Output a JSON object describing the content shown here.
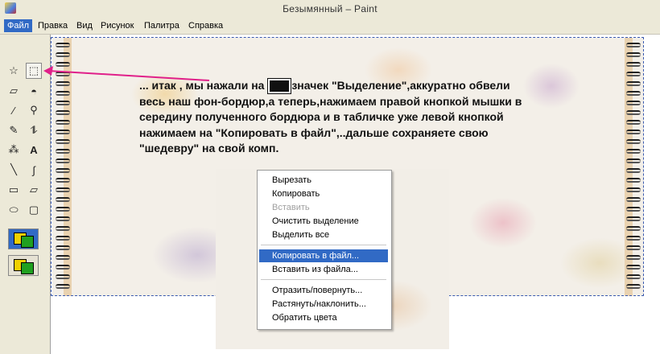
{
  "window": {
    "title": "Безымянный – Paint"
  },
  "menubar": {
    "items": [
      {
        "label": "Файл",
        "active": true
      },
      {
        "label": "Правка"
      },
      {
        "label": "Вид"
      },
      {
        "label": "Рисунок"
      },
      {
        "label": "Палитра"
      },
      {
        "label": "Справка"
      }
    ]
  },
  "toolbox": {
    "tools": [
      {
        "name": "free-form-select-icon",
        "glyph": "☆"
      },
      {
        "name": "select-icon",
        "glyph": "⬚",
        "selected": true
      },
      {
        "name": "eraser-icon",
        "glyph": "▱"
      },
      {
        "name": "fill-icon",
        "glyph": "◓"
      },
      {
        "name": "eyedropper-icon",
        "glyph": "⁄"
      },
      {
        "name": "magnifier-icon",
        "glyph": "⚲"
      },
      {
        "name": "pencil-icon",
        "glyph": "✎"
      },
      {
        "name": "brush-icon",
        "glyph": "⥮"
      },
      {
        "name": "airbrush-icon",
        "glyph": "⁂"
      },
      {
        "name": "text-icon",
        "glyph": "A"
      },
      {
        "name": "line-icon",
        "glyph": "╲"
      },
      {
        "name": "curve-icon",
        "glyph": "∫"
      },
      {
        "name": "rectangle-icon",
        "glyph": "▭"
      },
      {
        "name": "polygon-icon",
        "glyph": "▱"
      },
      {
        "name": "ellipse-icon",
        "glyph": "⬭"
      },
      {
        "name": "rounded-rectangle-icon",
        "glyph": "▢"
      }
    ]
  },
  "canvas": {
    "instruction_part1": "... итак , мы нажали на ",
    "instruction_part2": "значек \"Выделение\",аккуратно обвели весь наш фон-бордюр,а теперь,нажимаем правой кнопкой мышки в середину полученного бордюра и в табличке уже левой кнопкой нажимаем на \"Копировать в файл\",..дальше сохраняете свою \"шедевру\" на свой комп."
  },
  "context_menu": {
    "items": [
      {
        "label": "Вырезать"
      },
      {
        "label": "Копировать"
      },
      {
        "label": "Вставить",
        "disabled": true
      },
      {
        "label": "Очистить выделение"
      },
      {
        "label": "Выделить все"
      },
      {
        "label": "Копировать в файл...",
        "highlighted": true
      },
      {
        "label": "Вставить из файла..."
      },
      {
        "label": "Отразить/повернуть..."
      },
      {
        "label": "Растянуть/наклонить..."
      },
      {
        "label": "Обратить цвета"
      }
    ]
  },
  "colors": {
    "highlight": "#316ac5",
    "arrow": "#e0208a",
    "chrome": "#ece9d8"
  }
}
